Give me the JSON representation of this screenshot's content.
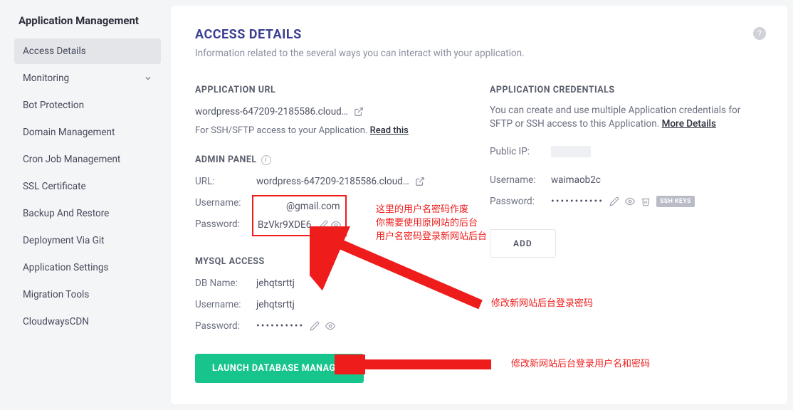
{
  "sidebar": {
    "title": "Application Management",
    "items": [
      {
        "label": "Access Details",
        "active": true,
        "chevron": false
      },
      {
        "label": "Monitoring",
        "active": false,
        "chevron": true
      },
      {
        "label": "Bot Protection",
        "active": false,
        "chevron": false
      },
      {
        "label": "Domain Management",
        "active": false,
        "chevron": false
      },
      {
        "label": "Cron Job Management",
        "active": false,
        "chevron": false
      },
      {
        "label": "SSL Certificate",
        "active": false,
        "chevron": false
      },
      {
        "label": "Backup And Restore",
        "active": false,
        "chevron": false
      },
      {
        "label": "Deployment Via Git",
        "active": false,
        "chevron": false
      },
      {
        "label": "Application Settings",
        "active": false,
        "chevron": false
      },
      {
        "label": "Migration Tools",
        "active": false,
        "chevron": false
      },
      {
        "label": "CloudwaysCDN",
        "active": false,
        "chevron": false
      }
    ]
  },
  "page": {
    "title": "ACCESS DETAILS",
    "subtitle": "Information related to the several ways you can interact with your application."
  },
  "app_url": {
    "header": "APPLICATION URL",
    "value": "wordpress-647209-2185586.cloud…",
    "ssh_note_prefix": "For SSH/SFTP access to your Application. ",
    "ssh_note_link": "Read this"
  },
  "admin_panel": {
    "header": "ADMIN PANEL",
    "url_label": "URL:",
    "url_value": "wordpress-647209-2185586.cloud…",
    "username_label": "Username:",
    "username_value": "@gmail.com",
    "password_label": "Password:",
    "password_value": "BzVkr9XDE6"
  },
  "mysql": {
    "header": "MYSQL ACCESS",
    "dbname_label": "DB Name:",
    "dbname_value": "jehqtsrttj",
    "username_label": "Username:",
    "username_value": "jehqtsrttj",
    "password_label": "Password:",
    "password_value": "••••••••••"
  },
  "launch_button": "LAUNCH DATABASE MANAGER",
  "credentials": {
    "header": "APPLICATION CREDENTIALS",
    "desc_prefix": "You can create and use multiple Application credentials for SFTP or SSH access to this Application. ",
    "desc_link": "More Details",
    "public_ip_label": "Public IP:",
    "username_label": "Username:",
    "username_value": "waimaob2c",
    "password_label": "Password:",
    "password_value": "•••••••••••",
    "ssh_badge": "SSH KEYS",
    "add_button": "ADD"
  },
  "annotations": {
    "admin_note": "这里的用户名密码作废\n你需要使用原网站的后台\n用户名密码登录新网站后台",
    "arrow1_label": "修改新网站后台登录密码",
    "arrow2_label": "修改新网站后台登录用户名和密码"
  }
}
